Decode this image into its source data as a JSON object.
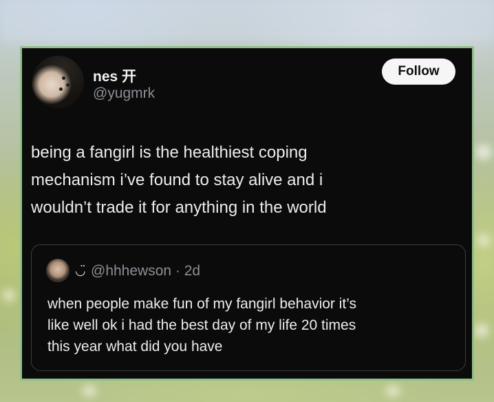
{
  "tweet": {
    "author": {
      "display_name": "nes 开",
      "handle": "@yugmrk"
    },
    "follow_label": "Follow",
    "text_lines": [
      "being a fangirl is the healthiest coping",
      "mechanism i’ve found to stay alive and i",
      "wouldn’t trade it for anything in the world"
    ],
    "quoted": {
      "emoji": "◡̈",
      "handle_and_time": "@hhhewson · 2d",
      "text_lines": [
        "when people make fun of my fangirl behavior it’s",
        "like well ok i had the best day of my life 20 times",
        "this year what did you have"
      ]
    }
  },
  "colors": {
    "card_background": "#0b0b0b",
    "card_border": "#8fbf8a",
    "secondary_text": "#8b9096",
    "follow_button": "#f6f6f6"
  }
}
